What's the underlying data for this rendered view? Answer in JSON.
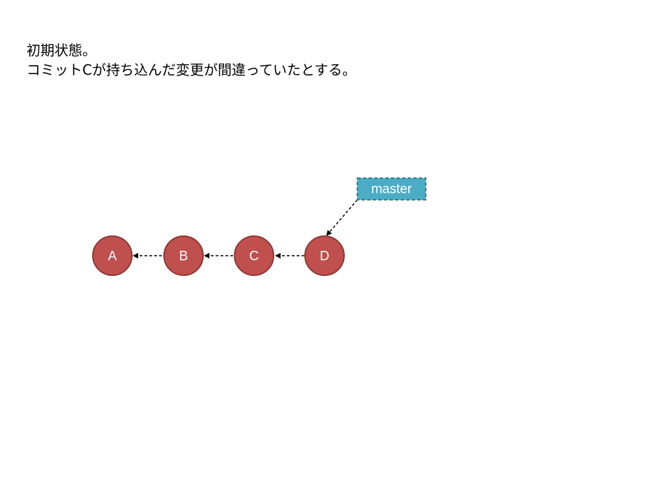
{
  "caption": {
    "line1": "初期状態。",
    "line2": "コミットCが持ち込んだ変更が間違っていたとする。"
  },
  "commits": [
    {
      "id": "A"
    },
    {
      "id": "B"
    },
    {
      "id": "C"
    },
    {
      "id": "D"
    }
  ],
  "branch": {
    "name": "master",
    "target": "D"
  },
  "edges": [
    {
      "from": "B",
      "to": "A"
    },
    {
      "from": "C",
      "to": "B"
    },
    {
      "from": "D",
      "to": "C"
    },
    {
      "from": "master",
      "to": "D"
    }
  ],
  "colors": {
    "commit_fill": "#c0504d",
    "commit_stroke": "#8c3836",
    "branch_fill": "#4bacc6",
    "branch_stroke": "#357d91",
    "arrow": "#000000",
    "label_text": "#ffffff"
  }
}
